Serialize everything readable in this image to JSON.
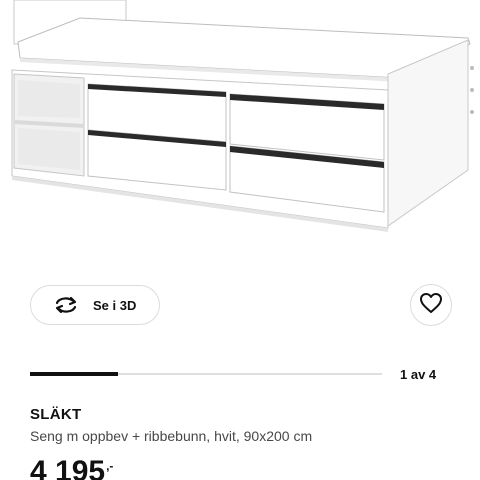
{
  "product_image": {
    "alt": "SLÄKT bed with storage drawers, white"
  },
  "view_3d": {
    "label": "Se i 3D",
    "icon": "rotate-arrows-icon"
  },
  "favourite": {
    "icon": "heart-icon"
  },
  "carousel": {
    "counter": "1 av 4",
    "current": 1,
    "total": 4
  },
  "product": {
    "name": "SLÄKT",
    "description": "Seng m oppbev + ribbebunn, hvit, 90x200 cm",
    "price_integer": "4 195",
    "price_decimals": ",-"
  },
  "colors": {
    "text": "#111111",
    "muted": "#484848",
    "border": "#dcdcdc",
    "track": "#dfdfdf"
  }
}
